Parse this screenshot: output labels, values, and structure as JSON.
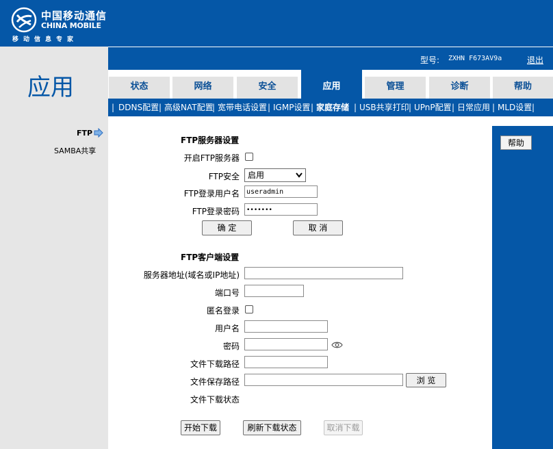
{
  "header": {
    "brand_cn": "中国移动通信",
    "brand_en": "CHINA MOBILE",
    "slogan": "移动信息专家",
    "model_label": "型号:",
    "model_value": "ZXHN F673AV9a",
    "logout": "退出"
  },
  "page_title": "应用",
  "tabs": [
    {
      "label": "状态",
      "active": false
    },
    {
      "label": "网络",
      "active": false
    },
    {
      "label": "安全",
      "active": false
    },
    {
      "label": "应用",
      "active": true
    },
    {
      "label": "管理",
      "active": false
    },
    {
      "label": "诊断",
      "active": false
    },
    {
      "label": "帮助",
      "active": false
    }
  ],
  "subnav": [
    {
      "label": "DDNS配置"
    },
    {
      "label": "高级NAT配置"
    },
    {
      "label": "宽带电话设置"
    },
    {
      "label": "IGMP设置"
    },
    {
      "label": "家庭存储",
      "active": true
    },
    {
      "label": "USB共享打印"
    },
    {
      "label": "UPnP配置"
    },
    {
      "label": "日常应用"
    },
    {
      "label": "MLD设置"
    }
  ],
  "subnav_sep": "|",
  "left_menu": {
    "ftp": "FTP",
    "samba": "SAMBA共享"
  },
  "help": {
    "button": "帮助"
  },
  "ftp_server": {
    "title": "FTP服务器设置",
    "enable_label": "开启FTP服务器",
    "security_label": "FTP安全",
    "security_value": "启用",
    "user_label": "FTP登录用户名",
    "user_value": "useradmin",
    "pass_label": "FTP登录密码",
    "pass_value": "•••••••",
    "confirm": "确 定",
    "cancel": "取 消"
  },
  "ftp_client": {
    "title": "FTP客户端设置",
    "server_label": "服务器地址(域名或IP地址)",
    "port_label": "端口号",
    "anon_label": "匿名登录",
    "user_label": "用户名",
    "pass_label": "密码",
    "download_path_label": "文件下载路径",
    "save_path_label": "文件保存路径",
    "browse": "浏 览",
    "status_label": "文件下载状态",
    "start": "开始下载",
    "refresh": "刷新下载状态",
    "cancel_download": "取消下载"
  },
  "colors": {
    "brand_blue": "#0557a7",
    "panel_gray": "#e6e6e6"
  }
}
